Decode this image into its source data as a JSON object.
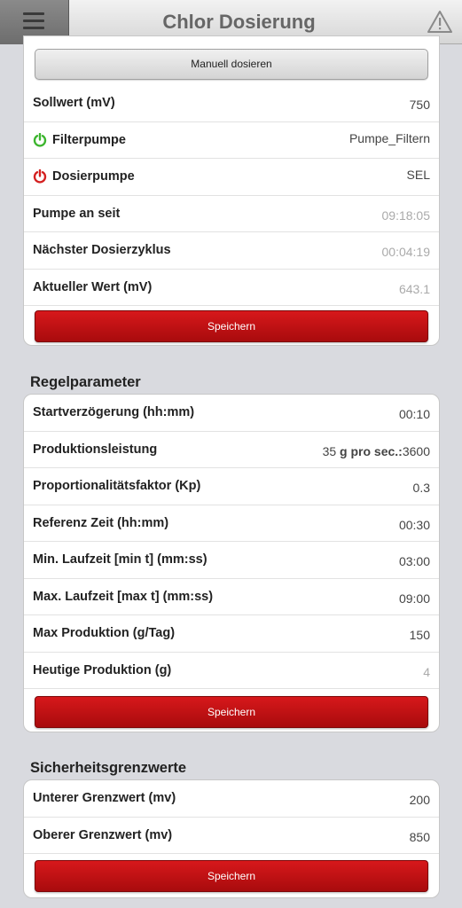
{
  "header": {
    "title": "Chlor Dosierung"
  },
  "dosing": {
    "manual_button": "Manuell dosieren",
    "rows": [
      {
        "label": "Sollwert (mV)",
        "value": "750"
      },
      {
        "label": "Filterpumpe",
        "value": "Pumpe_Filtern"
      },
      {
        "label": "Dosierpumpe",
        "value": "SEL"
      },
      {
        "label": "Pumpe an seit",
        "value": "09:18:05"
      },
      {
        "label": "Nächster Dosierzyklus",
        "value": "00:04:19"
      },
      {
        "label": "Aktueller Wert (mV)",
        "value": "643.1"
      }
    ],
    "save_button": "Speichern"
  },
  "regel": {
    "title": "Regelparameter",
    "rows": [
      {
        "label": "Startverzögerung (hh:mm)",
        "value": "00:10"
      },
      {
        "label": "Produktionsleistung",
        "value_prefix": "35",
        "value_unit": "g pro sec.:",
        "value": "3600"
      },
      {
        "label": "Proportionalitätsfaktor (Kp)",
        "value": "0.3"
      },
      {
        "label": "Referenz Zeit (hh:mm)",
        "value": "00:30"
      },
      {
        "label": "Min. Laufzeit [min t] (mm:ss)",
        "value": "03:00"
      },
      {
        "label": "Max. Laufzeit [max t] (mm:ss)",
        "value": "09:00"
      },
      {
        "label": "Max Produktion (g/Tag)",
        "value": "150"
      },
      {
        "label": "Heutige Produktion (g)",
        "value": "4"
      }
    ],
    "save_button": "Speichern"
  },
  "sicherheit": {
    "title": "Sicherheitsgrenzwerte",
    "rows": [
      {
        "label": "Unterer Grenzwert (mv)",
        "value": "200"
      },
      {
        "label": "Oberer Grenzwert (mv)",
        "value": "850"
      }
    ],
    "save_button": "Speichern"
  },
  "colors": {
    "accent_red": "#c41214",
    "power_on": "#3cb52e",
    "power_off": "#d42020",
    "background": "#d9dadf"
  },
  "icons": {
    "menu": "hamburger-menu-icon",
    "warning": "warning-triangle-icon",
    "power": "power-icon"
  }
}
